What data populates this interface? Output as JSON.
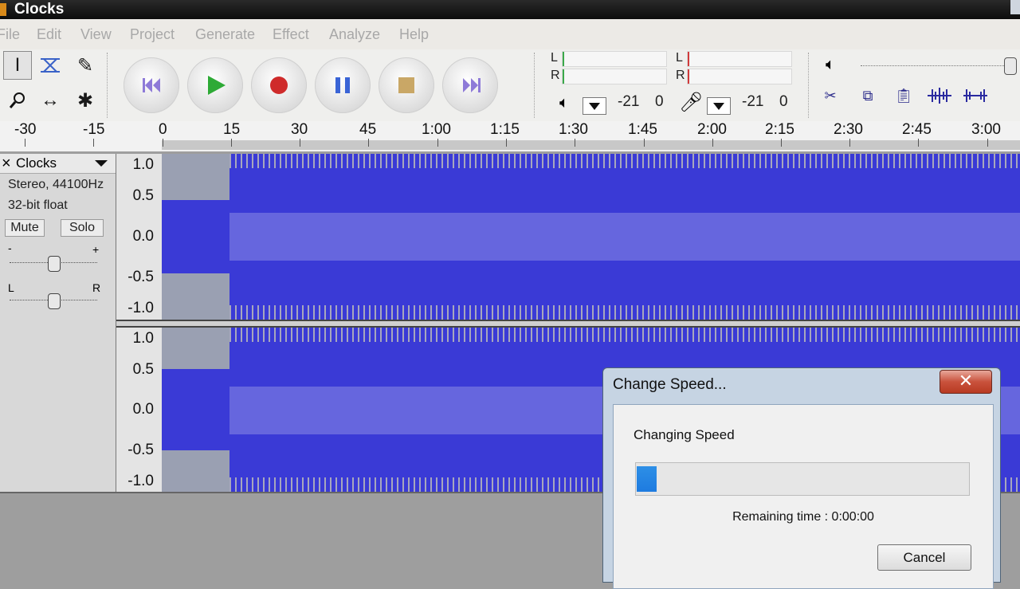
{
  "window": {
    "title": "Clocks"
  },
  "menu": [
    "File",
    "Edit",
    "View",
    "Project",
    "Generate",
    "Effect",
    "Analyze",
    "Help"
  ],
  "meters": {
    "playback": {
      "l": "L",
      "r": "R",
      "min": "-21",
      "max": "0"
    },
    "record": {
      "l": "L",
      "r": "R",
      "min": "-21",
      "max": "0"
    }
  },
  "ruler": {
    "labels": [
      "-30",
      "-15",
      "0",
      "15",
      "30",
      "45",
      "1:00",
      "1:15",
      "1:30",
      "1:45",
      "2:00",
      "2:15",
      "2:30",
      "2:45",
      "3:00"
    ]
  },
  "track": {
    "close": "×",
    "name": "Clocks",
    "format": "Stereo, 44100Hz",
    "bits": "32-bit float",
    "mute": "Mute",
    "solo": "Solo",
    "gain_minus": "-",
    "gain_plus": "+",
    "pan_left": "L",
    "pan_right": "R"
  },
  "scale": [
    "1.0",
    "0.5",
    "0.0",
    "-0.5",
    "-1.0"
  ],
  "dialog": {
    "title": "Change Speed...",
    "close": "✕",
    "message": "Changing Speed",
    "progress": 0.06,
    "remaining": "Remaining time : 0:00:00",
    "cancel": "Cancel"
  },
  "colors": {
    "waveform": "#3a3ad6",
    "waveform_rms": "#6666de",
    "progress": "#1e7be0",
    "close_button": "#c9523c"
  }
}
